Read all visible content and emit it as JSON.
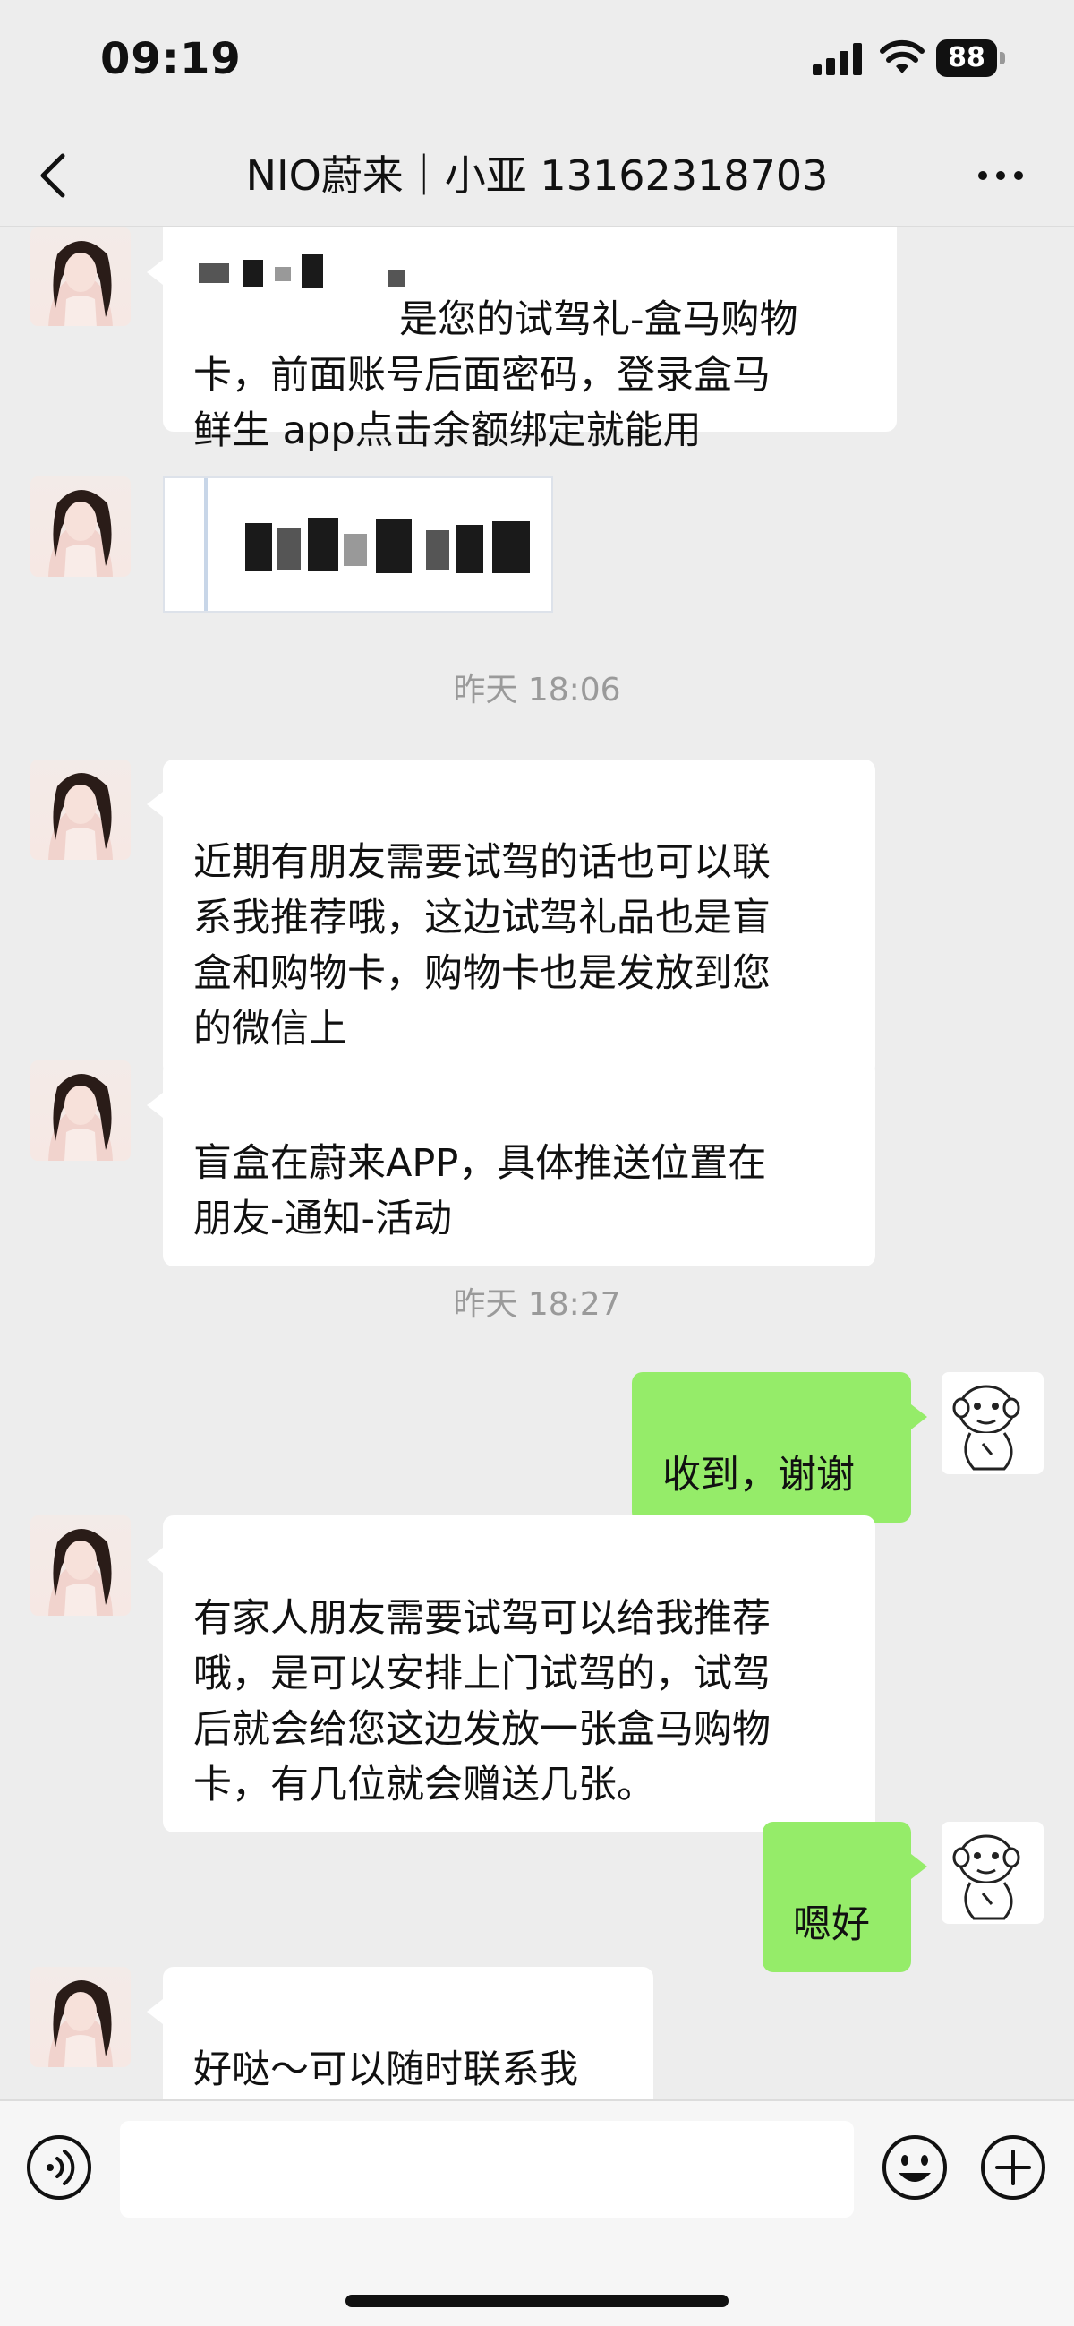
{
  "status_bar": {
    "time": "09:19",
    "battery_level": "88"
  },
  "nav": {
    "title": "NIO蔚来｜小亚 13162318703"
  },
  "messages": [
    {
      "text": "是您的试驾礼-盒马购物\n卡，前面账号后面密码，登录盒马\n鲜生 app点击余额绑定就能用"
    },
    {
      "text": "近期有朋友需要试驾的话也可以联\n系我推荐哦，这边试驾礼品也是盲\n盒和购物卡，购物卡也是发放到您\n的微信上"
    },
    {
      "text": "盲盒在蔚来APP，具体推送位置在\n朋友-通知-活动"
    },
    {
      "text": "收到，谢谢"
    },
    {
      "text": "有家人朋友需要试驾可以给我推荐\n哦，是可以安排上门试驾的，试驾\n后就会给您这边发放一张盒马购物\n卡，有几位就会赠送几张。"
    },
    {
      "text": "嗯好"
    },
    {
      "text": "好哒～可以随时联系我"
    }
  ],
  "dividers": [
    "昨天 18:06",
    "昨天 18:27"
  ],
  "input": {
    "placeholder": ""
  },
  "colors": {
    "background": "#ededed",
    "outgoing_bubble": "#95ec69",
    "incoming_bubble": "#ffffff"
  },
  "icons": [
    "signal-icon",
    "wifi-icon",
    "battery-icon",
    "back-icon",
    "more-icon",
    "voice-icon",
    "emoji-icon",
    "plus-icon"
  ]
}
